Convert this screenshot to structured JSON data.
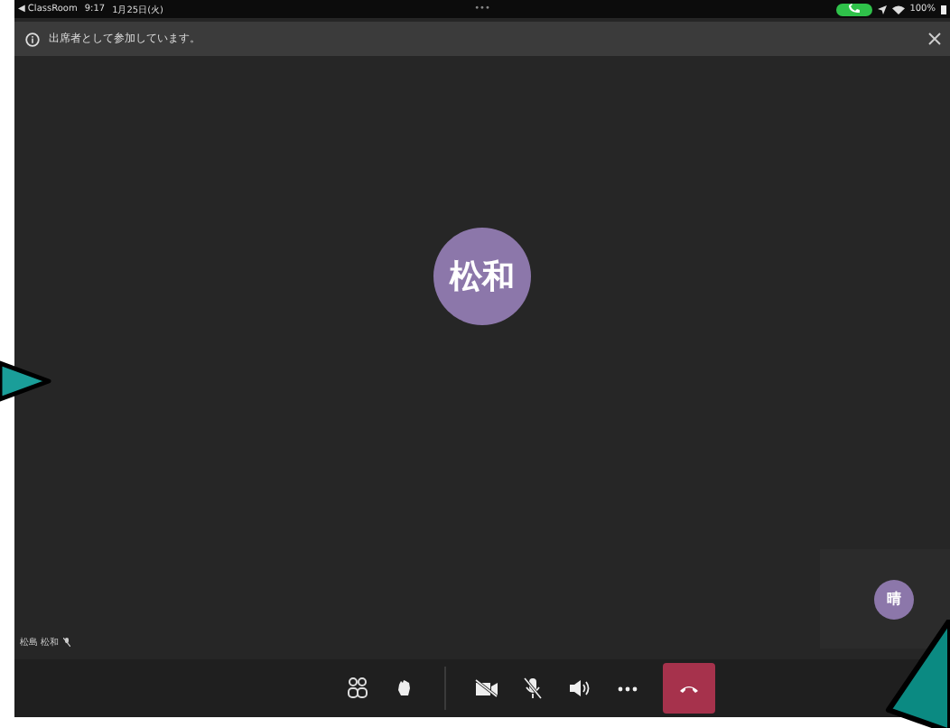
{
  "status_bar": {
    "back_label": "◀ ClassRoom",
    "time": "9:17",
    "date": "1月25日(火)",
    "dots": "•••",
    "battery": "100%"
  },
  "banner": {
    "text": "出席者として参加しています。"
  },
  "stage": {
    "main_avatar": "松和",
    "participant_name": "松島 松和",
    "tile_avatar": "晴"
  },
  "controls": [
    {
      "kind": "people"
    },
    {
      "kind": "hand"
    },
    {
      "kind": "divider"
    },
    {
      "kind": "camera_off"
    },
    {
      "kind": "mic_off"
    },
    {
      "kind": "speaker"
    },
    {
      "kind": "more"
    },
    {
      "kind": "hangup"
    }
  ]
}
